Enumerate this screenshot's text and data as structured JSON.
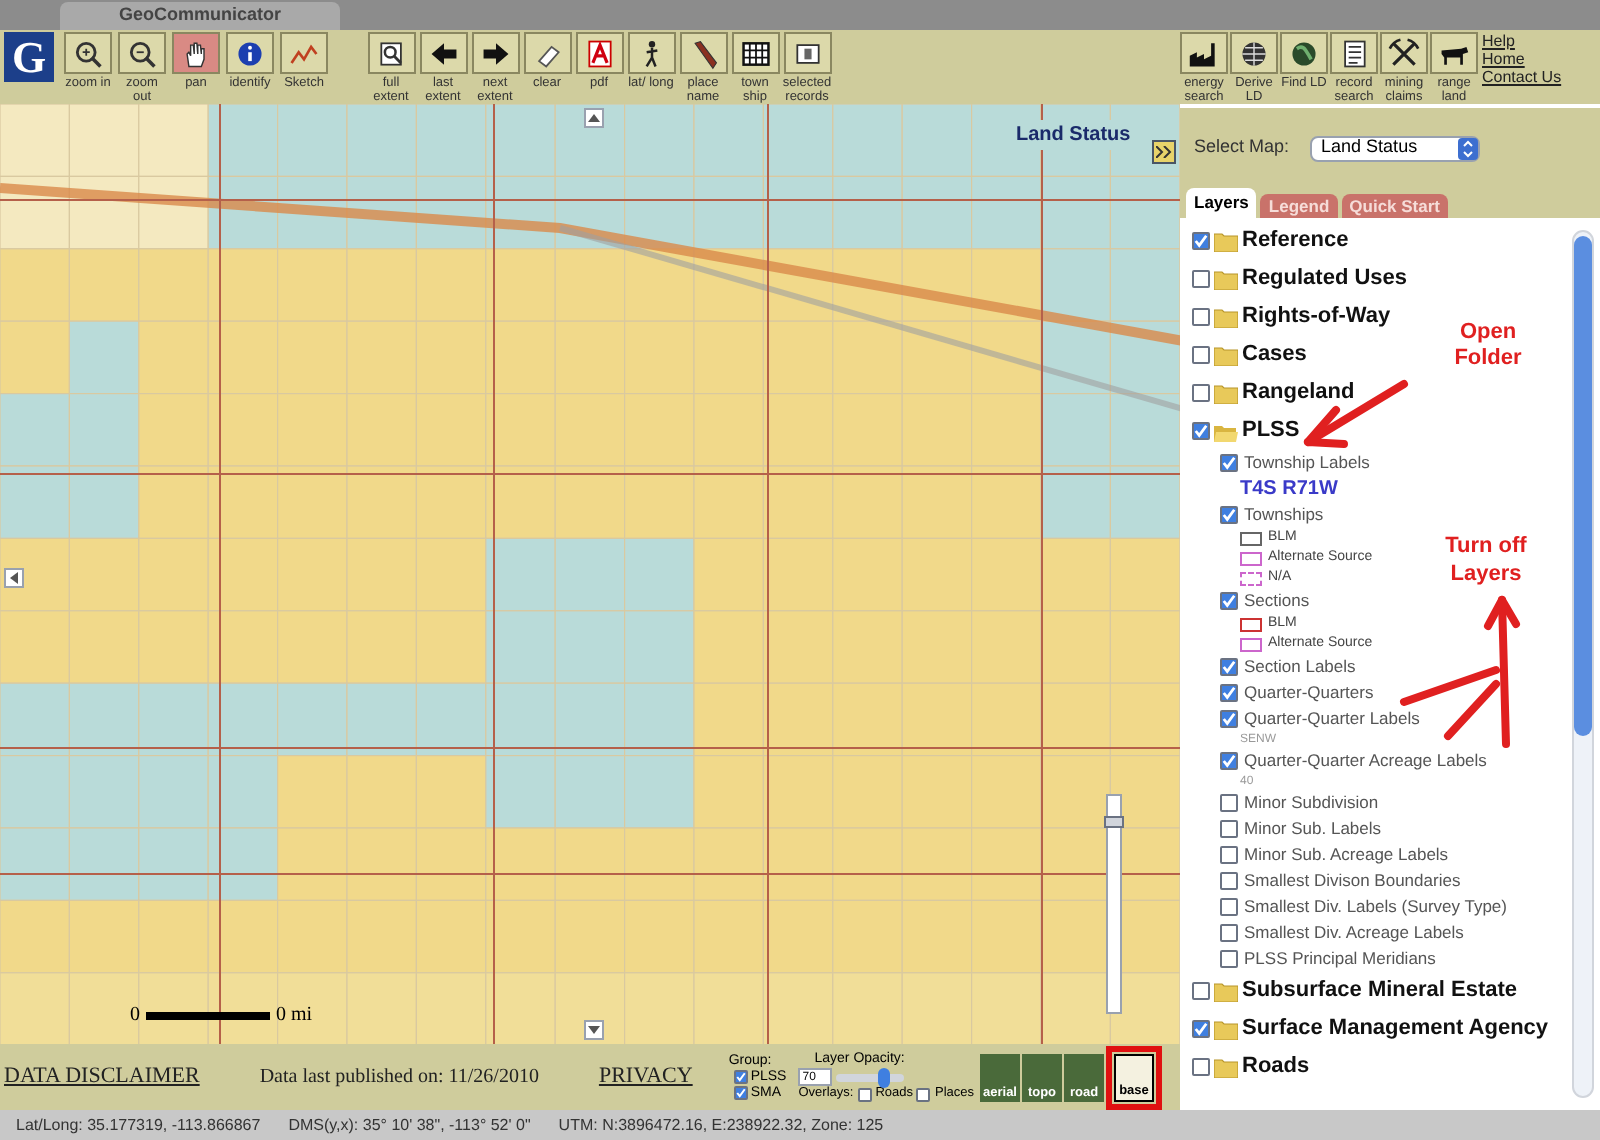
{
  "window": {
    "title": "GeoCommunicator"
  },
  "toolbar": {
    "logo": "G",
    "tools": [
      {
        "kind": "zoom-in",
        "label": "zoom in",
        "selected": false
      },
      {
        "kind": "zoom-out",
        "label": "zoom out",
        "selected": false
      },
      {
        "kind": "pan",
        "label": "pan",
        "selected": true
      },
      {
        "kind": "identify",
        "label": "identify",
        "selected": false
      },
      {
        "kind": "sketch",
        "label": "Sketch",
        "selected": false
      }
    ],
    "actions": [
      {
        "kind": "full-extent",
        "label": "full extent"
      },
      {
        "kind": "last-extent",
        "label": "last extent"
      },
      {
        "kind": "next-extent",
        "label": "next extent"
      },
      {
        "kind": "clear",
        "label": "clear"
      },
      {
        "kind": "pdf",
        "label": "pdf"
      },
      {
        "kind": "lat-long",
        "label": "lat/ long"
      },
      {
        "kind": "place-name",
        "label": "place name"
      },
      {
        "kind": "township",
        "label": "town ship"
      },
      {
        "kind": "selected-records",
        "label": "selected records"
      }
    ],
    "searches": [
      {
        "kind": "energy",
        "label": "energy search"
      },
      {
        "kind": "derive",
        "label": "Derive LD"
      },
      {
        "kind": "find",
        "label": "Find LD"
      },
      {
        "kind": "record",
        "label": "record search"
      },
      {
        "kind": "mining",
        "label": "mining claims"
      },
      {
        "kind": "range",
        "label": "range land"
      }
    ],
    "links": [
      "Help",
      "Home",
      "Contact Us"
    ]
  },
  "map": {
    "title": "Land Status",
    "zoom": {
      "level": 0.9
    },
    "scale": {
      "start": "0",
      "end": "0 mi"
    }
  },
  "select_map": {
    "label": "Select Map:",
    "value": "Land Status"
  },
  "tabs": [
    {
      "label": "Layers",
      "selected": true
    },
    {
      "label": "Legend",
      "selected": false
    },
    {
      "label": "Quick Start",
      "selected": false
    }
  ],
  "layers": [
    {
      "label": "Reference",
      "checked": true,
      "expanded": false
    },
    {
      "label": "Regulated Uses",
      "checked": false,
      "expanded": false
    },
    {
      "label": "Rights-of-Way",
      "checked": false,
      "expanded": false
    },
    {
      "label": "Cases",
      "checked": false,
      "expanded": false
    },
    {
      "label": "Rangeland",
      "checked": false,
      "expanded": false
    },
    {
      "label": "PLSS",
      "checked": true,
      "expanded": true,
      "children": [
        {
          "label": "Township Labels",
          "checked": true,
          "sample": "T4S R71W"
        },
        {
          "label": "Townships",
          "checked": true,
          "legend": [
            {
              "label": "BLM",
              "color": "#666666",
              "kind": "solid"
            },
            {
              "label": "Alternate Source",
              "color": "#cc66cc",
              "kind": "solid"
            },
            {
              "label": "N/A",
              "color": "#cc66cc",
              "kind": "dashed"
            }
          ]
        },
        {
          "label": "Sections",
          "checked": true,
          "legend": [
            {
              "label": "BLM",
              "color": "#cc3333",
              "kind": "solid"
            },
            {
              "label": "Alternate Source",
              "color": "#cc66cc",
              "kind": "solid"
            }
          ]
        },
        {
          "label": "Section Labels",
          "checked": true
        },
        {
          "label": "Quarter-Quarters",
          "checked": true
        },
        {
          "label": "Quarter-Quarter Labels",
          "checked": true,
          "sample": "SENW"
        },
        {
          "label": "Quarter-Quarter Acreage Labels",
          "checked": true,
          "sample": "40"
        },
        {
          "label": "Minor Subdivision",
          "checked": false
        },
        {
          "label": "Minor Sub. Labels",
          "checked": false
        },
        {
          "label": "Minor Sub. Acreage Labels",
          "checked": false
        },
        {
          "label": "Smallest Divison Boundaries",
          "checked": false
        },
        {
          "label": "Smallest Div. Labels (Survey Type)",
          "checked": false
        },
        {
          "label": "Smallest Div. Acreage Labels",
          "checked": false
        },
        {
          "label": "PLSS Principal Meridians",
          "checked": false
        }
      ]
    },
    {
      "label": "Subsurface Mineral Estate",
      "checked": false,
      "expanded": false
    },
    {
      "label": "Surface Management Agency",
      "checked": true,
      "expanded": false
    },
    {
      "label": "Roads",
      "checked": false,
      "expanded": false
    }
  ],
  "annotations": [
    {
      "text": "Open Folder"
    },
    {
      "text": "Turn off Layers"
    }
  ],
  "footer": {
    "disclaimer": "DATA DISCLAIMER",
    "published": "Data last published on: 11/26/2010",
    "privacy": "PRIVACY",
    "group": {
      "label": "Group:",
      "items": [
        {
          "label": "PLSS",
          "checked": true
        },
        {
          "label": "SMA",
          "checked": true
        }
      ]
    },
    "opacity": {
      "label": "Layer Opacity:",
      "value": "70",
      "level": 0.7
    },
    "overlays": {
      "label": "Overlays:",
      "items": [
        {
          "label": "Roads",
          "checked": false
        },
        {
          "label": "Places",
          "checked": false
        }
      ]
    },
    "basemaps": [
      {
        "label": "aerial",
        "selected": false
      },
      {
        "label": "topo",
        "selected": false
      },
      {
        "label": "road",
        "selected": false
      },
      {
        "label": "base",
        "selected": true
      }
    ]
  },
  "status_bar": [
    "Lat/Long: 35.177319, -113.866867",
    "DMS(y,x): 35° 10' 38\", -113° 52' 0\"",
    "UTM: N:3896472.16, E:238922.32, Zone: 125"
  ]
}
